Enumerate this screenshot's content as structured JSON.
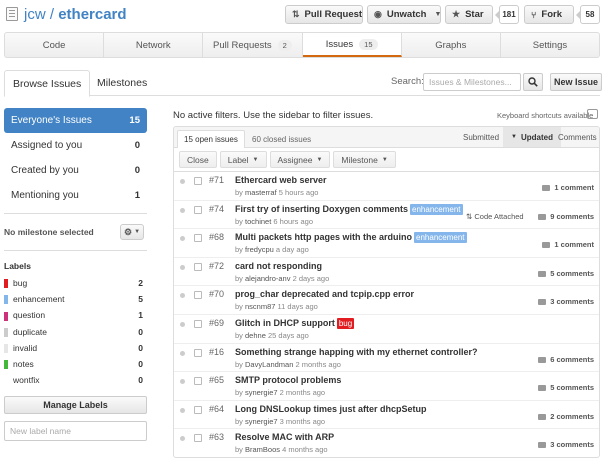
{
  "header": {
    "owner": "jcw",
    "separator": " / ",
    "repo": "ethercard",
    "pull_request": "Pull Request",
    "unwatch": "Unwatch",
    "star": "Star",
    "star_count": "181",
    "fork": "Fork",
    "fork_count": "58"
  },
  "tabs": [
    {
      "label": "Code"
    },
    {
      "label": "Network"
    },
    {
      "label": "Pull Requests",
      "count": "2"
    },
    {
      "label": "Issues",
      "count": "15"
    },
    {
      "label": "Graphs"
    },
    {
      "label": "Settings"
    }
  ],
  "subnav": {
    "browse": "Browse Issues",
    "milestones": "Milestones",
    "search_label": "Search:",
    "search_placeholder": "Issues & Milestones...",
    "new_issue": "New Issue"
  },
  "sidebar": {
    "filters": [
      {
        "label": "Everyone's Issues",
        "count": "15"
      },
      {
        "label": "Assigned to you",
        "count": "0"
      },
      {
        "label": "Created by you",
        "count": "0"
      },
      {
        "label": "Mentioning you",
        "count": "1"
      }
    ],
    "milestone": "No milestone selected",
    "labels_title": "Labels",
    "labels": [
      {
        "name": "bug",
        "count": "2",
        "color": "#e11d21"
      },
      {
        "name": "enhancement",
        "count": "5",
        "color": "#84b6eb"
      },
      {
        "name": "question",
        "count": "1",
        "color": "#cc317c"
      },
      {
        "name": "duplicate",
        "count": "0",
        "color": "#cccccc"
      },
      {
        "name": "invalid",
        "count": "0",
        "color": "#e6e6e6"
      },
      {
        "name": "notes",
        "count": "0",
        "color": "#42b73a"
      },
      {
        "name": "wontfix",
        "count": "0",
        "color": "#ffffff"
      }
    ],
    "manage_labels": "Manage Labels",
    "new_label_placeholder": "New label name"
  },
  "main": {
    "no_filters": "No active filters. Use the sidebar to filter issues.",
    "keyboard": "Keyboard shortcuts available",
    "open_tab": "15 open issues",
    "closed_tab": "60 closed issues",
    "sort_submitted": "Submitted",
    "sort_updated": "Updated",
    "sort_comments": "Comments",
    "close": "Close",
    "label": "Label",
    "assignee": "Assignee",
    "milestone": "Milestone"
  },
  "issues": [
    {
      "num": "#71",
      "title": "Ethercard web server",
      "tag": "",
      "author": "masterraf",
      "ago": "5 hours ago",
      "comments": "1 comment"
    },
    {
      "num": "#74",
      "title": "First try of inserting Doxygen comments",
      "tag": "enhancement",
      "author": "tochinet",
      "ago": "6 hours ago",
      "comments": "9 comments",
      "attached": "Code Attached"
    },
    {
      "num": "#68",
      "title": "Multi packets http pages with the arduino",
      "tag": "enhancement",
      "author": "fredycpu",
      "ago": "a day ago",
      "comments": "1 comment"
    },
    {
      "num": "#72",
      "title": "card not responding",
      "tag": "",
      "author": "alejandro-anv",
      "ago": "2 days ago",
      "comments": "5 comments"
    },
    {
      "num": "#70",
      "title": "prog_char deprecated and tcpip.cpp error",
      "tag": "",
      "author": "nscnm87",
      "ago": "11 days ago",
      "comments": "3 comments"
    },
    {
      "num": "#69",
      "title": "Glitch in DHCP support",
      "tag": "bug",
      "author": "dehne",
      "ago": "25 days ago",
      "comments": ""
    },
    {
      "num": "#16",
      "title": "Something strange happing with my ethernet controller?",
      "tag": "",
      "author": "DavyLandman",
      "ago": "2 months ago",
      "comments": "6 comments"
    },
    {
      "num": "#65",
      "title": "SMTP protocol problems",
      "tag": "",
      "author": "synergie7",
      "ago": "2 months ago",
      "comments": "5 comments"
    },
    {
      "num": "#64",
      "title": "Long DNSLookup times just after dhcpSetup",
      "tag": "",
      "author": "synergie7",
      "ago": "3 months ago",
      "comments": "2 comments"
    },
    {
      "num": "#63",
      "title": "Resolve MAC with ARP",
      "tag": "",
      "author": "BramBoos",
      "ago": "4 months ago",
      "comments": "3 comments"
    }
  ],
  "tag_colors": {
    "enhancement": "#84b6eb",
    "bug": "#e11d21"
  }
}
